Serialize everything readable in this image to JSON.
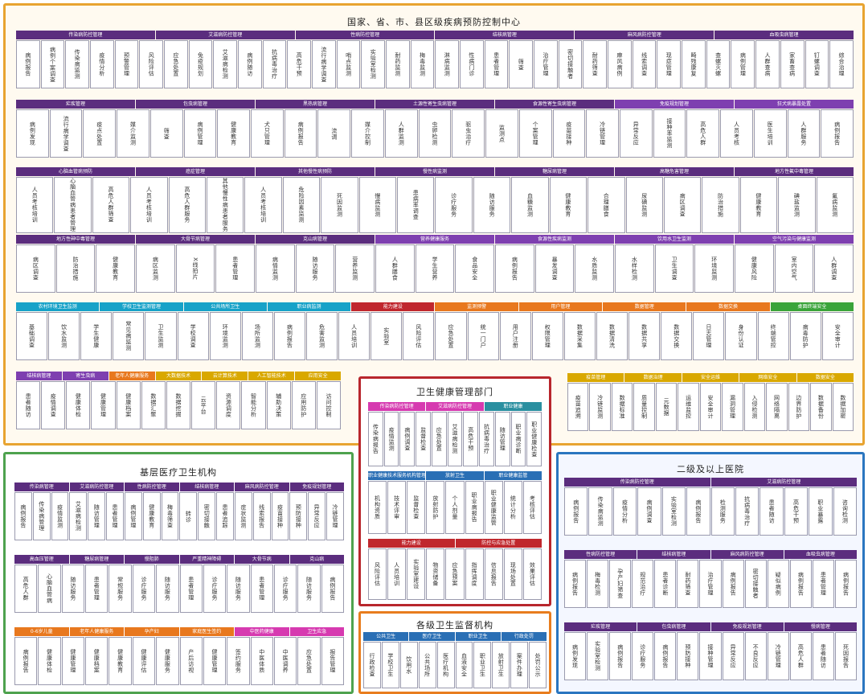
{
  "colors": {
    "purple": "#5b2d7e",
    "violet": "#7e3fb0",
    "cyan": "#17a2c8",
    "orange": "#e8781e",
    "red": "#c0272d",
    "blue": "#2a6fb5",
    "yellow": "#d9a800",
    "magenta": "#d63ab0",
    "green": "#3aa43a",
    "teal": "#2a8fa0"
  },
  "regions": {
    "national": "国家、省、市、县区级疾病预防控制中心",
    "grassroots": "基层医疗卫生机构",
    "health_dept": "卫生健康管理部门",
    "hospital": "二级及以上医院",
    "supervision": "各级卫生监督机构"
  },
  "bands": [
    {
      "id": "n1",
      "heads": [
        {
          "t": "传染病防控管理",
          "c": "purple"
        },
        {
          "t": "艾滋病防控管理",
          "c": "purple"
        },
        {
          "t": "性病防控管理",
          "c": "purple"
        },
        {
          "t": "结核病管理",
          "c": "purple"
        },
        {
          "t": "麻风病防控管理",
          "c": "purple"
        },
        {
          "t": "血吸虫病管理",
          "c": "purple"
        }
      ],
      "cells": [
        "病例报告",
        "病例个案调查",
        "传染病监测",
        "疫情分析",
        "预警管理",
        "风险评估",
        "应急处置",
        "免疫规划",
        "艾滋病检测",
        "病例随访",
        "抗病毒治疗",
        "高危干预",
        "流行病学调查",
        "哨点监测",
        "实验室检测",
        "耐药监测",
        "梅毒监测",
        "淋病监测",
        "性病门诊",
        "患者管理",
        "筛查",
        "治疗管理",
        "密切接触者",
        "耐药筛查",
        "麻风病例",
        "线索调查",
        "现症管理",
        "畸残康复",
        "查螺灭螺",
        "病例管理",
        "人群查病",
        "家畜查病",
        "钉螺调查",
        "综合治理"
      ]
    },
    {
      "id": "n2",
      "heads": [
        {
          "t": "疟疾管理",
          "c": "purple"
        },
        {
          "t": "包虫病管理",
          "c": "purple"
        },
        {
          "t": "黑热病管理",
          "c": "purple"
        },
        {
          "t": "土源性寄生虫病管理",
          "c": "purple"
        },
        {
          "t": "食源性寄生虫病管理",
          "c": "purple"
        },
        {
          "t": "免疫规划管理",
          "c": "violet"
        },
        {
          "t": "狂犬病暴露处置",
          "c": "violet"
        }
      ],
      "cells": [
        "病例发现",
        "流行病学调查",
        "疫点处置",
        "媒介监测",
        "筛查",
        "病例管理",
        "健康教育",
        "犬只管理",
        "病例报告",
        "流调",
        "媒介控制",
        "人群监测",
        "虫卵检测",
        "驱虫治疗",
        "监测点",
        "个案管理",
        "疫苗接种",
        "冷链管理",
        "异常反应",
        "接种率监测",
        "高危人群",
        "人员考核",
        "医生培训",
        "人群服务",
        "病例报告"
      ]
    },
    {
      "id": "n3",
      "heads": [
        {
          "t": "心脑血管病预防",
          "c": "purple"
        },
        {
          "t": "癌症管理",
          "c": "purple"
        },
        {
          "t": "其他慢性病预防",
          "c": "purple"
        },
        {
          "t": "慢性病监测",
          "c": "purple"
        },
        {
          "t": "糖尿病管理",
          "c": "purple"
        },
        {
          "t": "高糖危害管理",
          "c": "purple"
        },
        {
          "t": "地方性氟中毒管理",
          "c": "purple"
        }
      ],
      "cells": [
        "人员考核培训",
        "心脑血管病患者管理",
        "高危人群筛查",
        "人员考核培训",
        "高危人群服务",
        "其他慢性病患者服务",
        "人员考核培训",
        "危险因素监测",
        "死因监测",
        "慢病监测",
        "患病率调查",
        "诊疗服务",
        "随访服务",
        "血糖监测",
        "健康教育",
        "合理膳食",
        "尿碘监测",
        "病区调查",
        "防治措施",
        "健康教育",
        "碘盐监测",
        "氟病监测"
      ]
    },
    {
      "id": "n4",
      "heads": [
        {
          "t": "地方性砷中毒管理",
          "c": "purple"
        },
        {
          "t": "大骨节病管理",
          "c": "purple"
        },
        {
          "t": "克山病管理",
          "c": "purple"
        },
        {
          "t": "营养健康服务",
          "c": "violet"
        },
        {
          "t": "食源性疾病监测",
          "c": "violet"
        },
        {
          "t": "饮用水卫生监测",
          "c": "violet"
        },
        {
          "t": "空气污染与健康监测",
          "c": "violet"
        }
      ],
      "cells": [
        "病区调查",
        "防治措施",
        "健康教育",
        "病区监测",
        "X线拍片",
        "患者管理",
        "病情监测",
        "随访服务",
        "营养监测",
        "人群膳食",
        "学生营养",
        "食品安全",
        "病例报告",
        "暴发调查",
        "水质监测",
        "水样检测",
        "卫生调查",
        "环境监测",
        "健康风险",
        "室内空气",
        "人群调查"
      ]
    },
    {
      "id": "n5",
      "heads": [
        {
          "t": "农村环境卫生监测",
          "c": "cyan"
        },
        {
          "t": "学校卫生监测管理",
          "c": "cyan"
        },
        {
          "t": "公共场所卫生",
          "c": "cyan"
        },
        {
          "t": "职业病监测",
          "c": "cyan"
        },
        {
          "t": "能力建设",
          "c": "red"
        },
        {
          "t": "监测预警",
          "c": "orange"
        },
        {
          "t": "用户管理",
          "c": "orange"
        },
        {
          "t": "数据管理",
          "c": "orange"
        },
        {
          "t": "数据交换",
          "c": "orange"
        },
        {
          "t": "桌面终端安全",
          "c": "green"
        }
      ],
      "cells": [
        "基础调查",
        "饮水监测",
        "学生健康",
        "常见病监测",
        "卫生监测",
        "学校调查",
        "环境监测",
        "场所监测",
        "病例报告",
        "危害监测",
        "人员培训",
        "实验室",
        "风险评估",
        "应急处置",
        "统一门户",
        "用户注册",
        "权限管理",
        "数据采集",
        "数据清洗",
        "数据共享",
        "数据交换",
        "日志管理",
        "身份认证",
        "终端管控",
        "病毒防护",
        "安全审计"
      ]
    },
    {
      "id": "n6",
      "heads": [
        {
          "t": "结核病管理",
          "c": "violet"
        },
        {
          "t": "寄生虫病",
          "c": "violet"
        },
        {
          "t": "老年人健康服务",
          "c": "orange"
        },
        {
          "t": "大数据技术",
          "c": "yellow"
        },
        {
          "t": "云计算技术",
          "c": "yellow"
        },
        {
          "t": "人工智能技术",
          "c": "yellow"
        },
        {
          "t": "应用安全",
          "c": "yellow"
        }
      ],
      "cells": [
        "患者随访",
        "疫情调查",
        "健康体检",
        "健康管理",
        "健康档案",
        "数据汇聚",
        "数据挖掘",
        "云平台",
        "资源调度",
        "智能分析",
        "辅助决策",
        "应用防护",
        "访问控制"
      ]
    },
    {
      "id": "n7",
      "heads": [
        {
          "t": "疫苗管理",
          "c": "yellow"
        },
        {
          "t": "数据治理",
          "c": "yellow"
        },
        {
          "t": "安全运维",
          "c": "yellow"
        },
        {
          "t": "网络安全",
          "c": "yellow"
        },
        {
          "t": "数据安全",
          "c": "yellow"
        }
      ],
      "cells": [
        "疫苗追溯",
        "冷链监测",
        "数据标准",
        "质量控制",
        "元数据",
        "运维监控",
        "安全审计",
        "漏洞管理",
        "入侵检测",
        "网络隔离",
        "边界防护",
        "数据备份",
        "数据加密"
      ]
    },
    {
      "id": "h1",
      "heads": [
        {
          "t": "传染病防控管理",
          "c": "magenta"
        },
        {
          "t": "艾滋病防控管理",
          "c": "magenta"
        },
        {
          "t": "职业健康",
          "c": "teal"
        }
      ],
      "cells": [
        "传染病报告",
        "疫情监测",
        "病例调查",
        "监督检查",
        "应急处置",
        "艾滋病检测",
        "高危干预",
        "抗病毒治疗",
        "随访管理",
        "职业病诊断",
        "职业健康检查"
      ]
    },
    {
      "id": "h2",
      "heads": [
        {
          "t": "职业健康技术服务机构管理",
          "c": "blue"
        },
        {
          "t": "放射卫生",
          "c": "blue"
        },
        {
          "t": "职业健康监管",
          "c": "blue"
        }
      ],
      "cells": [
        "机构资质",
        "技术评审",
        "监督检查",
        "放射防护",
        "个人剂量",
        "职业病报告",
        "职业健康监管",
        "统计分析",
        "考核评估"
      ]
    },
    {
      "id": "h3",
      "heads": [
        {
          "t": "能力建设",
          "c": "red"
        },
        {
          "t": "防控与应急处置",
          "c": "red"
        }
      ],
      "cells": [
        "风险评估",
        "人员培训",
        "实验室建设",
        "物资储备",
        "应急预案",
        "指挥调度",
        "信息报告",
        "现场处置",
        "效果评估"
      ]
    },
    {
      "id": "s1",
      "heads": [
        {
          "t": "公共卫生",
          "c": "blue"
        },
        {
          "t": "医疗卫生",
          "c": "blue"
        },
        {
          "t": "职业卫生",
          "c": "blue"
        },
        {
          "t": "行政处罚",
          "c": "blue"
        }
      ],
      "cells": [
        "行政检查",
        "学校卫生",
        "饮用水",
        "公共场所",
        "医疗机构",
        "血液安全",
        "职业卫生",
        "放射卫生",
        "案件办理",
        "处罚公示"
      ]
    },
    {
      "id": "g1",
      "heads": [
        {
          "t": "传染病管理",
          "c": "purple"
        },
        {
          "t": "艾滋病防控管理",
          "c": "purple"
        },
        {
          "t": "性病防控管理",
          "c": "purple"
        },
        {
          "t": "结核病管理",
          "c": "purple"
        },
        {
          "t": "麻风病防控管理",
          "c": "purple"
        },
        {
          "t": "免疫规划管理",
          "c": "purple"
        }
      ],
      "cells": [
        "病例报告",
        "传染病管理",
        "疫情监测",
        "艾滋病检测",
        "随访管理",
        "患者管理",
        "病例管理",
        "健康教育",
        "梅毒筛查",
        "转诊",
        "密切接触",
        "患者追踪",
        "症状监测",
        "线索报告",
        "疫苗接种",
        "预防接种",
        "异常反应",
        "冷链管理"
      ]
    },
    {
      "id": "g2",
      "heads": [
        {
          "t": "高血压管理",
          "c": "purple"
        },
        {
          "t": "糖尿病管理",
          "c": "purple"
        },
        {
          "t": "慢阻肺",
          "c": "purple"
        },
        {
          "t": "严重精神障碍",
          "c": "purple"
        },
        {
          "t": "大骨节病",
          "c": "purple"
        },
        {
          "t": "克山病",
          "c": "purple"
        }
      ],
      "cells": [
        "高危人群",
        "心脑血管病",
        "随访服务",
        "患者管理",
        "常规服务",
        "诊疗服务",
        "随访服务",
        "患者管理",
        "诊疗服务",
        "随访服务",
        "患者管理",
        "诊疗服务",
        "随访服务",
        "病例报告"
      ]
    },
    {
      "id": "g3",
      "heads": [
        {
          "t": "0-6岁儿童",
          "c": "orange"
        },
        {
          "t": "老年人健康服务",
          "c": "orange"
        },
        {
          "t": "孕产妇",
          "c": "orange"
        },
        {
          "t": "家庭医生签约",
          "c": "orange"
        },
        {
          "t": "中医药健康",
          "c": "magenta"
        },
        {
          "t": "卫生应急",
          "c": "magenta"
        }
      ],
      "cells": [
        "病例报告",
        "健康体检",
        "健康管理",
        "健康档案",
        "健康教育",
        "健康评估",
        "健康服务",
        "产后访视",
        "健康管理",
        "签约服务",
        "中医体质",
        "中医调养",
        "应急处置",
        "报告管理"
      ]
    },
    {
      "id": "o1",
      "heads": [
        {
          "t": "传染病防控管理",
          "c": "purple"
        },
        {
          "t": "艾滋病防控管理",
          "c": "purple"
        }
      ],
      "cells": [
        "病例报告",
        "传染病监测",
        "疫情分析",
        "病例调查",
        "实验室检测",
        "病例报告",
        "检测服务",
        "抗病毒治疗",
        "患者随访",
        "高危干预",
        "职业暴露",
        "咨询检测"
      ]
    },
    {
      "id": "o2",
      "heads": [
        {
          "t": "性病防控管理",
          "c": "purple"
        },
        {
          "t": "结核病管理",
          "c": "purple"
        },
        {
          "t": "麻风病防控管理",
          "c": "purple"
        },
        {
          "t": "血吸虫病管理",
          "c": "purple"
        }
      ],
      "cells": [
        "病例报告",
        "梅毒检测",
        "孕产妇筛查",
        "规范治疗",
        "患者诊断",
        "耐药筛查",
        "治疗管理",
        "病例报告",
        "密切接触者",
        "疑似病例",
        "病例报告",
        "患者管理",
        "病例报告"
      ]
    },
    {
      "id": "o3",
      "heads": [
        {
          "t": "疟疾管理",
          "c": "purple"
        },
        {
          "t": "包虫病管理",
          "c": "purple"
        },
        {
          "t": "免疫规划管理",
          "c": "purple"
        },
        {
          "t": "慢病管理",
          "c": "purple"
        }
      ],
      "cells": [
        "病例发现",
        "实验室检测",
        "病例报告",
        "诊疗服务",
        "病例报告",
        "预防接种",
        "接种管理",
        "异常反应",
        "不良反应",
        "冷链管理",
        "高危人群",
        "患者随访",
        "死因报告"
      ]
    }
  ]
}
